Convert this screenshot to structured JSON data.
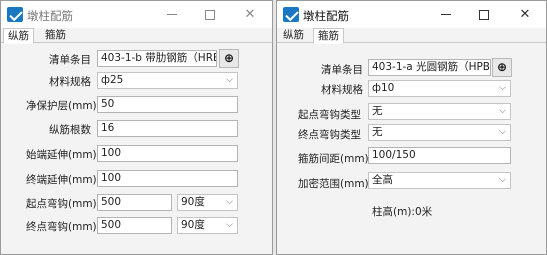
{
  "left_window": {
    "title": "墩柱配筋",
    "tabs": [
      "纵筋",
      "箍筋"
    ],
    "list_item_label": "清单条目",
    "list_item_value": "403-1-b 带肋钢筋（HRB4",
    "spec_label": "材料规格",
    "spec_value": "ф25",
    "cover_label": "净保护层(mm)",
    "cover_value": "50",
    "count_label": "纵筋根数",
    "count_value": "16",
    "start_ext_label": "始端延伸(mm)",
    "start_ext_value": "100",
    "end_ext_label": "终端延伸(mm)",
    "end_ext_value": "100",
    "start_hook_label": "起点弯钩(mm)",
    "start_hook_value": "500",
    "start_hook_angle": "90度",
    "end_hook_label": "终点弯钩(mm)",
    "end_hook_value": "500",
    "end_hook_angle": "90度"
  },
  "right_window": {
    "title": "墩柱配筋",
    "tabs": [
      "纵筋",
      "箍筋"
    ],
    "list_item_label": "清单条目",
    "list_item_value": "403-1-a 光圆钢筋（HPB3",
    "spec_label": "材料规格",
    "spec_value": "ф10",
    "start_hook_type_label": "起点弯钩类型",
    "start_hook_type_value": "无",
    "end_hook_type_label": "终点弯钩类型",
    "end_hook_type_value": "无",
    "spacing_label": "箍筋间距(mm)",
    "spacing_value": "100/150",
    "dense_range_label": "加密范围(mm)",
    "dense_range_value": "全高",
    "column_height_text": "柱高(m):0米"
  },
  "controls": {
    "minimize": "—",
    "maximize": "□",
    "close": "✕",
    "search_glyph": "⊕",
    "chevron": "⌵"
  }
}
